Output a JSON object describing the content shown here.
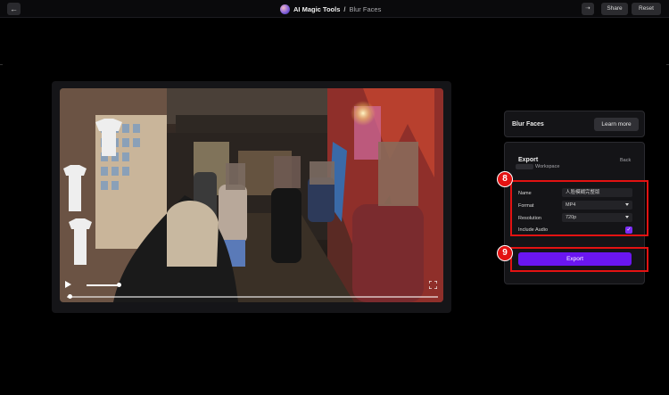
{
  "header": {
    "back_icon": "←",
    "app_title": "AI Magic Tools",
    "separator": "/",
    "page_title": "Blur Faces",
    "icon_button": "⇢",
    "share_label": "Share",
    "reset_label": "Reset"
  },
  "video": {
    "play_icon": "play-icon",
    "fullscreen_icon": "fullscreen-icon",
    "volume_level": 0.9,
    "progress": 0.02
  },
  "sidebar": {
    "title": "Blur Faces",
    "learn_more_label": "Learn more",
    "export": {
      "title": "Export",
      "workspace_label": "Workspace",
      "back_label": "Back",
      "fields": {
        "name_label": "Name",
        "name_value": "人脸模糊完整版",
        "format_label": "Format",
        "format_value": "MP4",
        "resolution_label": "Resolution",
        "resolution_value": "720p",
        "audio_label": "Include Audio",
        "audio_checked": true,
        "check_mark": "✓"
      },
      "export_button_label": "Export"
    }
  },
  "annotations": {
    "step_8": "8",
    "step_9": "9",
    "highlight_color": "#e31212"
  },
  "colors": {
    "accent": "#6a16f0",
    "panel": "#141417",
    "background": "#000000"
  }
}
